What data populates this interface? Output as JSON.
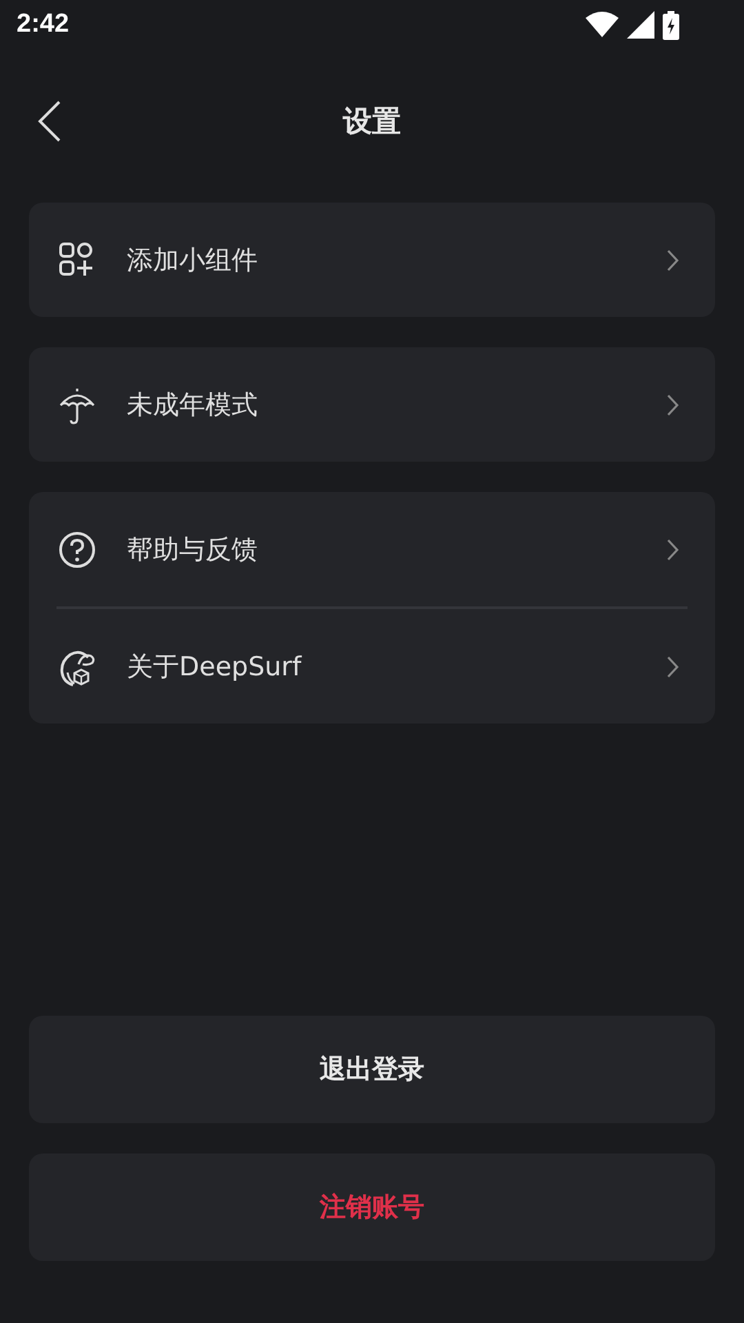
{
  "status_bar": {
    "time": "2:42"
  },
  "header": {
    "title": "设置"
  },
  "groups": [
    {
      "items": [
        {
          "kind": "widgets",
          "label": "添加小组件"
        }
      ]
    },
    {
      "items": [
        {
          "kind": "youth",
          "label": "未成年模式"
        }
      ]
    },
    {
      "items": [
        {
          "kind": "help",
          "label": "帮助与反馈"
        },
        {
          "kind": "about",
          "label": "关于DeepSurf"
        }
      ]
    }
  ],
  "buttons": [
    {
      "kind": "normal",
      "label": "退出登录"
    },
    {
      "kind": "danger",
      "label": "注销账号"
    }
  ]
}
